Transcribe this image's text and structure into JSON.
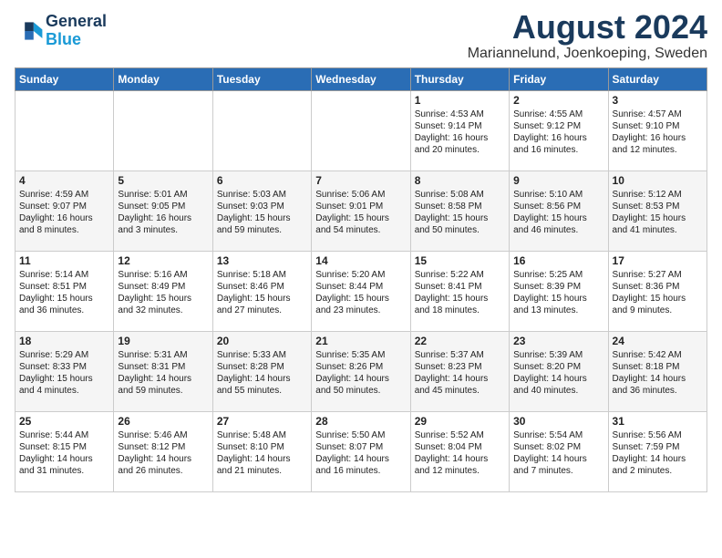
{
  "header": {
    "logo_line1": "General",
    "logo_line2": "Blue",
    "title": "August 2024",
    "subtitle": "Mariannelund, Joenkoeping, Sweden"
  },
  "days_of_week": [
    "Sunday",
    "Monday",
    "Tuesday",
    "Wednesday",
    "Thursday",
    "Friday",
    "Saturday"
  ],
  "weeks": [
    [
      {
        "day": "",
        "content": ""
      },
      {
        "day": "",
        "content": ""
      },
      {
        "day": "",
        "content": ""
      },
      {
        "day": "",
        "content": ""
      },
      {
        "day": "1",
        "content": "Sunrise: 4:53 AM\nSunset: 9:14 PM\nDaylight: 16 hours\nand 20 minutes."
      },
      {
        "day": "2",
        "content": "Sunrise: 4:55 AM\nSunset: 9:12 PM\nDaylight: 16 hours\nand 16 minutes."
      },
      {
        "day": "3",
        "content": "Sunrise: 4:57 AM\nSunset: 9:10 PM\nDaylight: 16 hours\nand 12 minutes."
      }
    ],
    [
      {
        "day": "4",
        "content": "Sunrise: 4:59 AM\nSunset: 9:07 PM\nDaylight: 16 hours\nand 8 minutes."
      },
      {
        "day": "5",
        "content": "Sunrise: 5:01 AM\nSunset: 9:05 PM\nDaylight: 16 hours\nand 3 minutes."
      },
      {
        "day": "6",
        "content": "Sunrise: 5:03 AM\nSunset: 9:03 PM\nDaylight: 15 hours\nand 59 minutes."
      },
      {
        "day": "7",
        "content": "Sunrise: 5:06 AM\nSunset: 9:01 PM\nDaylight: 15 hours\nand 54 minutes."
      },
      {
        "day": "8",
        "content": "Sunrise: 5:08 AM\nSunset: 8:58 PM\nDaylight: 15 hours\nand 50 minutes."
      },
      {
        "day": "9",
        "content": "Sunrise: 5:10 AM\nSunset: 8:56 PM\nDaylight: 15 hours\nand 46 minutes."
      },
      {
        "day": "10",
        "content": "Sunrise: 5:12 AM\nSunset: 8:53 PM\nDaylight: 15 hours\nand 41 minutes."
      }
    ],
    [
      {
        "day": "11",
        "content": "Sunrise: 5:14 AM\nSunset: 8:51 PM\nDaylight: 15 hours\nand 36 minutes."
      },
      {
        "day": "12",
        "content": "Sunrise: 5:16 AM\nSunset: 8:49 PM\nDaylight: 15 hours\nand 32 minutes."
      },
      {
        "day": "13",
        "content": "Sunrise: 5:18 AM\nSunset: 8:46 PM\nDaylight: 15 hours\nand 27 minutes."
      },
      {
        "day": "14",
        "content": "Sunrise: 5:20 AM\nSunset: 8:44 PM\nDaylight: 15 hours\nand 23 minutes."
      },
      {
        "day": "15",
        "content": "Sunrise: 5:22 AM\nSunset: 8:41 PM\nDaylight: 15 hours\nand 18 minutes."
      },
      {
        "day": "16",
        "content": "Sunrise: 5:25 AM\nSunset: 8:39 PM\nDaylight: 15 hours\nand 13 minutes."
      },
      {
        "day": "17",
        "content": "Sunrise: 5:27 AM\nSunset: 8:36 PM\nDaylight: 15 hours\nand 9 minutes."
      }
    ],
    [
      {
        "day": "18",
        "content": "Sunrise: 5:29 AM\nSunset: 8:33 PM\nDaylight: 15 hours\nand 4 minutes."
      },
      {
        "day": "19",
        "content": "Sunrise: 5:31 AM\nSunset: 8:31 PM\nDaylight: 14 hours\nand 59 minutes."
      },
      {
        "day": "20",
        "content": "Sunrise: 5:33 AM\nSunset: 8:28 PM\nDaylight: 14 hours\nand 55 minutes."
      },
      {
        "day": "21",
        "content": "Sunrise: 5:35 AM\nSunset: 8:26 PM\nDaylight: 14 hours\nand 50 minutes."
      },
      {
        "day": "22",
        "content": "Sunrise: 5:37 AM\nSunset: 8:23 PM\nDaylight: 14 hours\nand 45 minutes."
      },
      {
        "day": "23",
        "content": "Sunrise: 5:39 AM\nSunset: 8:20 PM\nDaylight: 14 hours\nand 40 minutes."
      },
      {
        "day": "24",
        "content": "Sunrise: 5:42 AM\nSunset: 8:18 PM\nDaylight: 14 hours\nand 36 minutes."
      }
    ],
    [
      {
        "day": "25",
        "content": "Sunrise: 5:44 AM\nSunset: 8:15 PM\nDaylight: 14 hours\nand 31 minutes."
      },
      {
        "day": "26",
        "content": "Sunrise: 5:46 AM\nSunset: 8:12 PM\nDaylight: 14 hours\nand 26 minutes."
      },
      {
        "day": "27",
        "content": "Sunrise: 5:48 AM\nSunset: 8:10 PM\nDaylight: 14 hours\nand 21 minutes."
      },
      {
        "day": "28",
        "content": "Sunrise: 5:50 AM\nSunset: 8:07 PM\nDaylight: 14 hours\nand 16 minutes."
      },
      {
        "day": "29",
        "content": "Sunrise: 5:52 AM\nSunset: 8:04 PM\nDaylight: 14 hours\nand 12 minutes."
      },
      {
        "day": "30",
        "content": "Sunrise: 5:54 AM\nSunset: 8:02 PM\nDaylight: 14 hours\nand 7 minutes."
      },
      {
        "day": "31",
        "content": "Sunrise: 5:56 AM\nSunset: 7:59 PM\nDaylight: 14 hours\nand 2 minutes."
      }
    ]
  ]
}
